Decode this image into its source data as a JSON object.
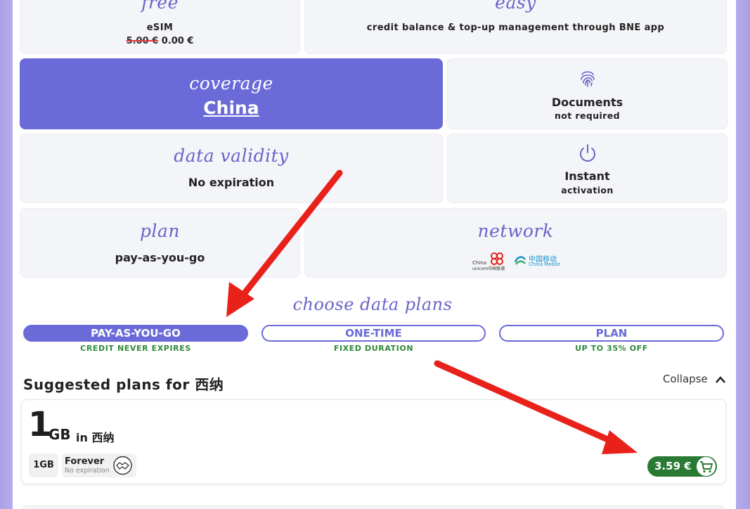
{
  "features": {
    "esim": {
      "script": "free",
      "label": "eSIM",
      "old_price": "5.00 €",
      "new_price": "0.00 €"
    },
    "easy": {
      "script": "easy",
      "label": "credit balance & top-up management through BNE app"
    },
    "coverage": {
      "script": "coverage",
      "country": "China"
    },
    "documents": {
      "icon": "fingerprint-icon",
      "title": "Documents",
      "subtitle": "not required"
    },
    "validity": {
      "script": "data validity",
      "value": "No expiration"
    },
    "activation": {
      "icon": "power-icon",
      "title": "Instant",
      "subtitle": "activation"
    },
    "plan": {
      "script": "plan",
      "value": "pay-as-you-go"
    },
    "network": {
      "script": "network",
      "carriers": [
        {
          "name": "China Unicom",
          "line1": "China",
          "line2": "unicom中国联通",
          "color": "#e2231a"
        },
        {
          "name": "China Mobile",
          "cn": "中国移动",
          "en": "China Mobile",
          "color": "#1b8fc9"
        }
      ]
    }
  },
  "choose": {
    "script": "choose data plans",
    "tabs": [
      {
        "label": "PAY-AS-YOU-GO",
        "sub": "CREDIT NEVER EXPIRES",
        "active": true
      },
      {
        "label": "ONE-TIME",
        "sub": "FIXED DURATION",
        "active": false
      },
      {
        "label": "PLAN",
        "sub": "UP TO 35% OFF",
        "active": false
      }
    ]
  },
  "suggested": {
    "heading": "Suggested plans for 西纳",
    "collapse_label": "Collapse",
    "plan": {
      "amount": "1",
      "unit": "GB",
      "in_label": "in 西纳",
      "chip": "1GB",
      "duration": "Forever",
      "duration_sub": "No expiration",
      "price": "3.59 €"
    }
  },
  "colors": {
    "accent": "#6a6bd8",
    "coverage_bg": "#6a6bd8",
    "green": "#2e8a3a",
    "price_green": "#2a7a35",
    "annotation_red": "#e8211a"
  }
}
